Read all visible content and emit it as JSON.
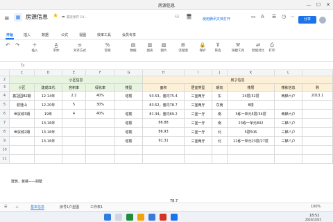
{
  "window": {
    "title": "房源信息",
    "controls": [
      "—",
      "☐",
      "✕"
    ]
  },
  "header": {
    "doc_title": "房源信息",
    "saved_status": "最近保存 19...",
    "open_in_wps": "使用腾讯文档打开",
    "share_label": "分享"
  },
  "menu_tabs": [
    "开始",
    "插入",
    "数据",
    "公式",
    "视图",
    "效率工具",
    "会员专享"
  ],
  "toolbar": {
    "undo": "撤销",
    "insert": "插入",
    "font": "字体",
    "align": "对齐方式",
    "number_format": "常规",
    "data": "数据",
    "chart": "图表",
    "image": "图片",
    "shape": "流程图",
    "lock": "保护",
    "filter": "筛选",
    "quick_tools": "快捷工具",
    "compare": "智能对比",
    "print": "打印"
  },
  "grid": {
    "columns": [
      "C",
      "D",
      "E",
      "F",
      "G",
      "H",
      "I",
      "J",
      "K",
      "L"
    ],
    "rows": [
      "2",
      "3",
      "4",
      "5",
      "6",
      "7",
      "8",
      "9",
      "10",
      "11"
    ],
    "group_headers": {
      "community": "小区信息",
      "house": "房子信息"
    },
    "headers": [
      "小区",
      "建成年代",
      "容积率",
      "绿化率",
      "楼型",
      "面积",
      "居室类型",
      "朝向",
      "楼层",
      "楼栋信息",
      "购"
    ],
    "data_rows": [
      [
        "鑫冠园B2期",
        "12-14年",
        "2.2",
        "40%",
        "塔楼",
        "93.53，套内75.4",
        "三室两厅",
        "东",
        "24层/32层",
        "两梯六户",
        "2013.1"
      ],
      [
        "碧桂山",
        "12-20年",
        "5",
        "30%",
        "",
        "83.52，套内78.7",
        "三室两厅",
        "东南",
        "8楼",
        "",
        ""
      ],
      [
        "世贸城3期",
        "19年",
        "4",
        "40%",
        "塔楼",
        "81.34，套内69.2",
        "三室一厅",
        "南",
        "3栋一单元5层/34层",
        "两梯六户",
        ""
      ],
      [
        "",
        "13-16年",
        "",
        "",
        "塔楼",
        "86.88",
        "三室一厅",
        "南",
        "23栋一单元802",
        "三梯八户",
        ""
      ],
      [
        "世贸城2期",
        "13-16年",
        "",
        "",
        "塔楼",
        "86.93",
        "三室一厅",
        "北",
        "5层506",
        "三梯八户",
        ""
      ],
      [
        "",
        "13-16年",
        "",
        "",
        "塔楼",
        "91.31",
        "三室两厅",
        "北",
        "21栋一单元23层/27层",
        "三梯八户",
        ""
      ]
    ],
    "note": "建筑，板楼——别墅",
    "partial_value": "78.7"
  },
  "sheets": [
    "基本信息",
    "房号1户型图",
    "工作表1"
  ],
  "zoom": "100%",
  "clock": {
    "time": "18:52",
    "date": "2024/10/25"
  }
}
